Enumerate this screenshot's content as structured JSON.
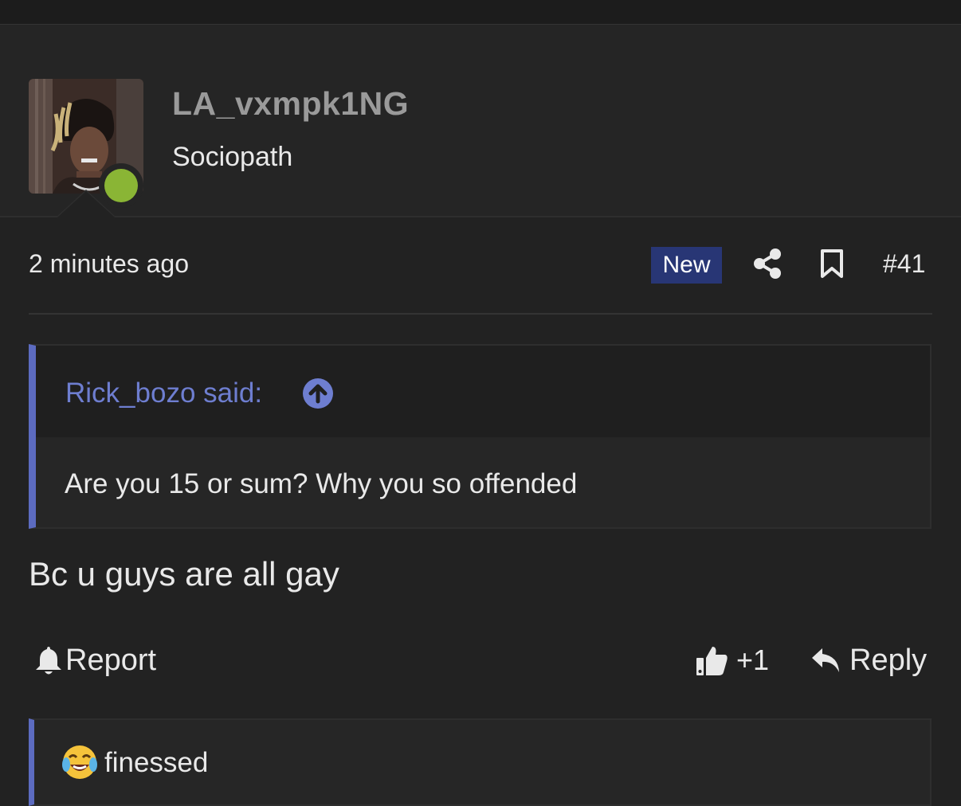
{
  "user": {
    "name": "LA_vxmpk1NG",
    "title": "Sociopath",
    "online": true
  },
  "post": {
    "time": "2 minutes ago",
    "new_badge": "New",
    "number": "#41",
    "body": "Bc u guys are all gay"
  },
  "quote": {
    "author": "Rick_bozo said:",
    "text": "Are you 15 or sum? Why you so offended"
  },
  "actions": {
    "report": "Report",
    "like_count": "+1",
    "reply": "Reply"
  },
  "signature": {
    "emoji": "face-with-tears-of-joy-icon",
    "text": "finessed"
  },
  "colors": {
    "background": "#222222",
    "accent": "#5c6bc0",
    "quote_author": "#6e7ed0",
    "new_badge": "#283675",
    "online": "#8ab535",
    "username": "#9a9a9a"
  },
  "icons": {
    "share": "share-icon",
    "bookmark": "bookmark-icon",
    "quote_jump": "arrow-up-circle-icon",
    "report": "bell-icon",
    "like": "thumbs-up-icon",
    "reply": "reply-icon"
  }
}
